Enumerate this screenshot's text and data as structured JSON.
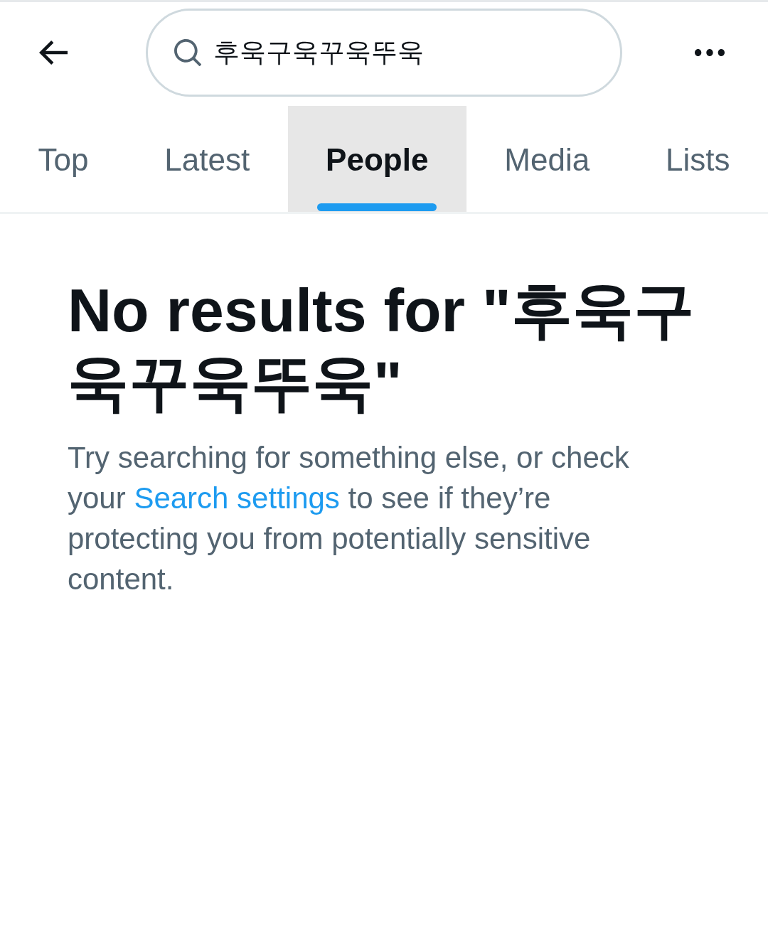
{
  "header": {
    "search_field": {
      "value": "후욱구욱꾸욱뚜욱"
    }
  },
  "tabs": [
    {
      "label": "Top",
      "selected": false
    },
    {
      "label": "Latest",
      "selected": false
    },
    {
      "label": "People",
      "selected": true
    },
    {
      "label": "Media",
      "selected": false
    },
    {
      "label": "Lists",
      "selected": false
    }
  ],
  "empty_state": {
    "title": "No results for \"후욱구욱꾸욱뚜욱\"",
    "message": {
      "before": "Try searching for something else, or check your ",
      "link": "Search settings",
      "after": " to see if they’re protecting you from potentially sensitive content."
    }
  }
}
